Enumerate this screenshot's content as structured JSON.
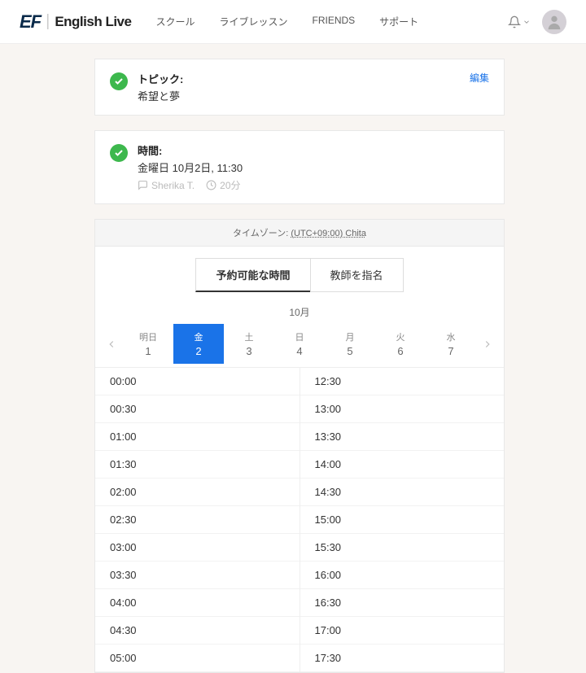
{
  "header": {
    "logo_ef": "EF",
    "logo_text": "English Live",
    "nav": [
      "スクール",
      "ライブレッスン",
      "FRIENDS",
      "サポート"
    ]
  },
  "topic_card": {
    "title": "トピック:",
    "value": "希望と夢",
    "edit_label": "編集"
  },
  "time_card": {
    "title": "時間:",
    "value": "金曜日 10月2日, 11:30",
    "teacher": "Sherika T.",
    "duration": "20分"
  },
  "timezone": {
    "prefix": "タイムゾーン: ",
    "link": "(UTC+09:00) Chita"
  },
  "tabs": {
    "available": "予約可能な時間",
    "teacher": "教師を指名"
  },
  "month": "10月",
  "dates": [
    {
      "day": "明日",
      "num": "1",
      "selected": false
    },
    {
      "day": "金",
      "num": "2",
      "selected": true
    },
    {
      "day": "土",
      "num": "3",
      "selected": false
    },
    {
      "day": "日",
      "num": "4",
      "selected": false
    },
    {
      "day": "月",
      "num": "5",
      "selected": false
    },
    {
      "day": "火",
      "num": "6",
      "selected": false
    },
    {
      "day": "水",
      "num": "7",
      "selected": false
    }
  ],
  "times_left": [
    "00:00",
    "00:30",
    "01:00",
    "01:30",
    "02:00",
    "02:30",
    "03:00",
    "03:30",
    "04:00",
    "04:30",
    "05:00"
  ],
  "times_right": [
    "12:30",
    "13:00",
    "13:30",
    "14:00",
    "14:30",
    "15:00",
    "15:30",
    "16:00",
    "16:30",
    "17:00",
    "17:30"
  ]
}
